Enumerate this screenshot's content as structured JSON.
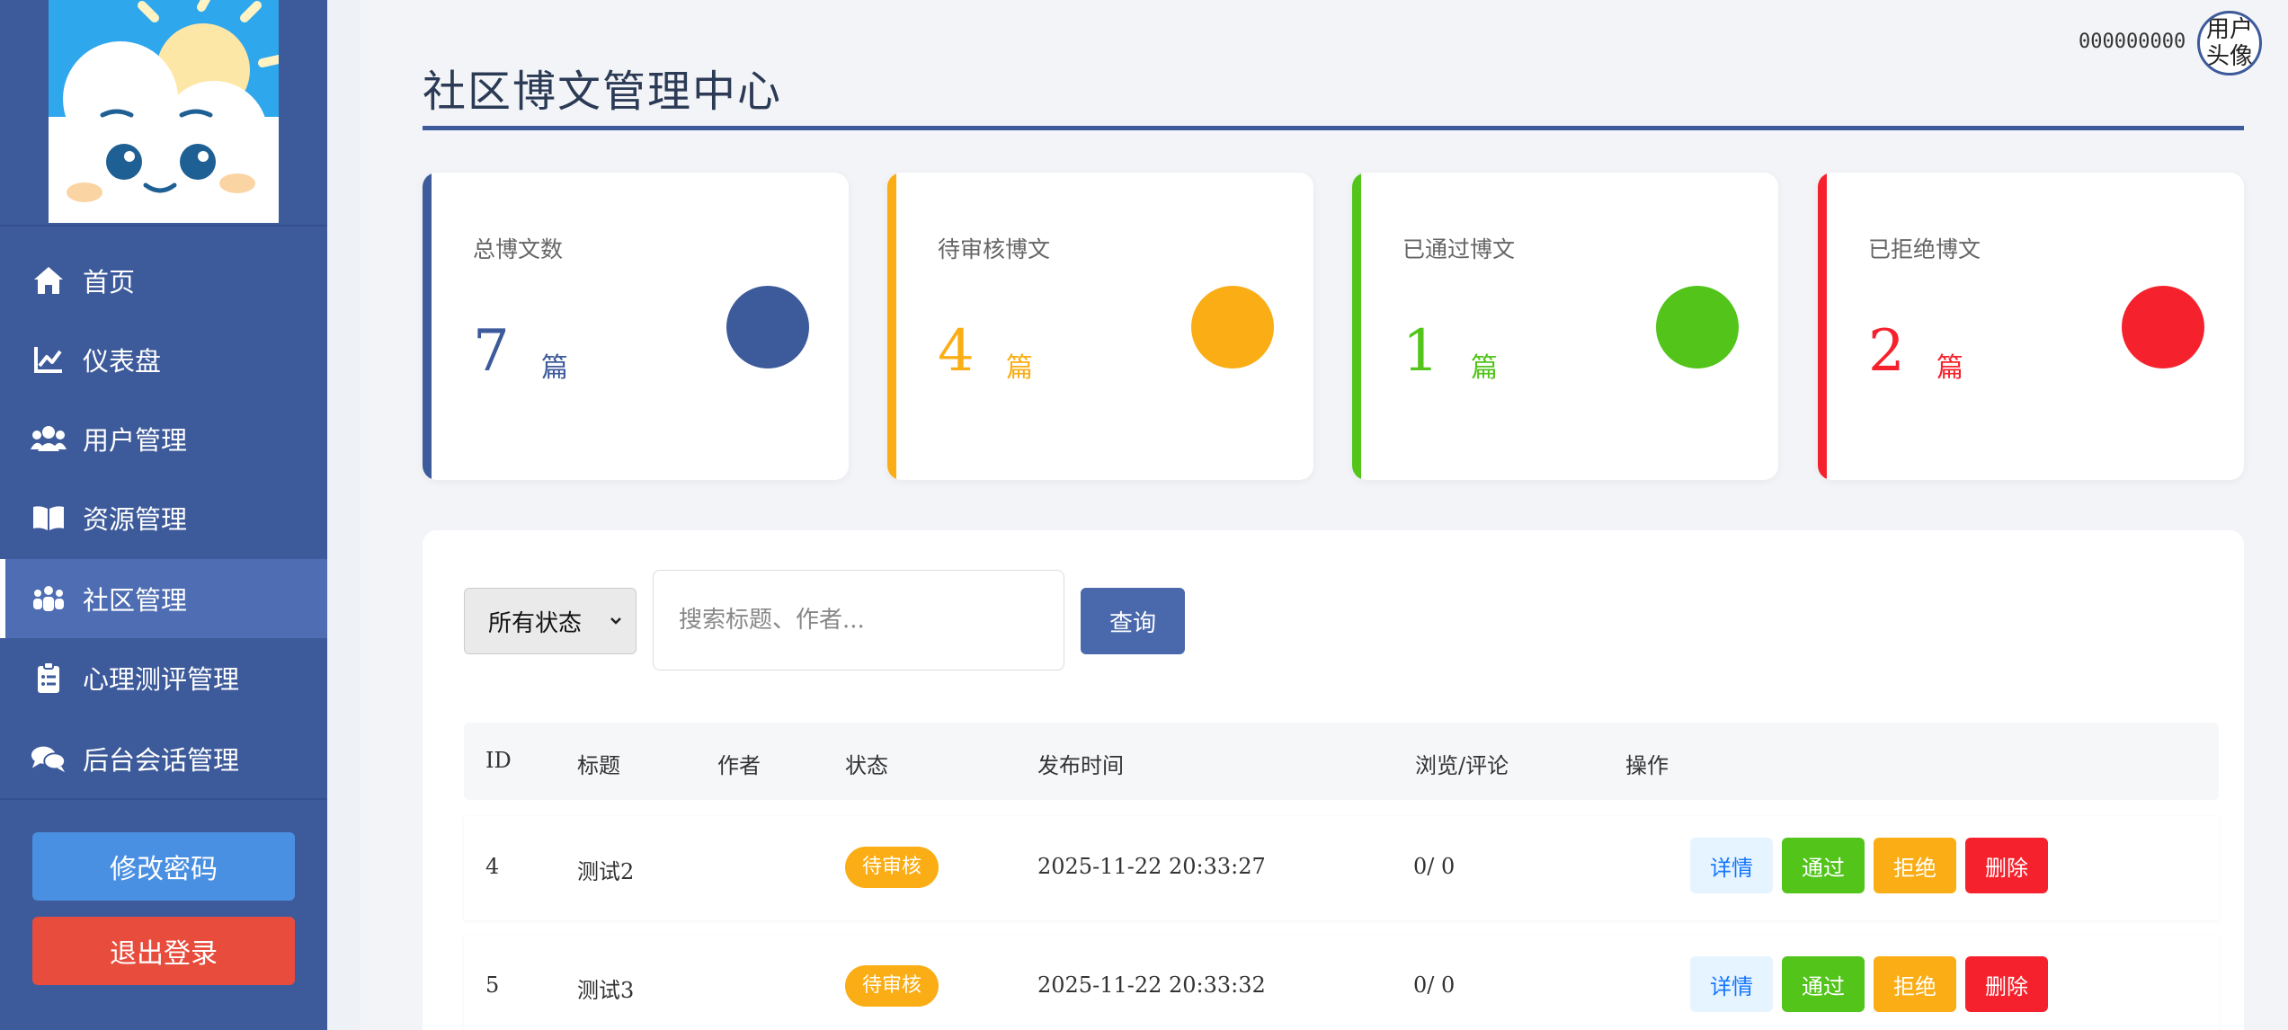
{
  "sidebar": {
    "items": [
      {
        "label": "首页",
        "icon": "home-icon"
      },
      {
        "label": "仪表盘",
        "icon": "chart-line-icon"
      },
      {
        "label": "用户管理",
        "icon": "users-icon"
      },
      {
        "label": "资源管理",
        "icon": "book-icon"
      },
      {
        "label": "社区管理",
        "icon": "people-group-icon",
        "active": true
      },
      {
        "label": "心理测评管理",
        "icon": "clipboard-list-icon"
      },
      {
        "label": "后台会话管理",
        "icon": "comments-icon"
      }
    ],
    "change_password": "修改密码",
    "logout": "退出登录"
  },
  "header": {
    "title": "社区博文管理中心",
    "user_id": "000000000",
    "avatar_text": "用户头像"
  },
  "stats": [
    {
      "label": "总博文数",
      "value": "7",
      "unit": "篇",
      "color": "#3d5a9b"
    },
    {
      "label": "待审核博文",
      "value": "4",
      "unit": "篇",
      "color": "#faad14"
    },
    {
      "label": "已通过博文",
      "value": "1",
      "unit": "篇",
      "color": "#52c41a"
    },
    {
      "label": "已拒绝博文",
      "value": "2",
      "unit": "篇",
      "color": "#f5222d"
    }
  ],
  "filters": {
    "status_selected": "所有状态",
    "search_placeholder": "搜索标题、作者...",
    "query_label": "查询"
  },
  "table": {
    "columns": [
      "ID",
      "标题",
      "作者",
      "状态",
      "发布时间",
      "浏览/评论",
      "操作"
    ],
    "rows": [
      {
        "id": "4",
        "title": "测试2",
        "author": "",
        "status": "待审核",
        "time": "2025-11-22 20:33:27",
        "views": "0/ 0"
      },
      {
        "id": "5",
        "title": "测试3",
        "author": "",
        "status": "待审核",
        "time": "2025-11-22 20:33:32",
        "views": "0/ 0"
      }
    ],
    "actions": {
      "detail": "详情",
      "pass": "通过",
      "reject": "拒绝",
      "delete": "删除"
    }
  },
  "colors": {
    "sidebar_bg": "#3d5a9b",
    "primary": "#3d5a9b",
    "pending": "#faad14",
    "approved": "#52c41a",
    "rejected": "#f5222d"
  }
}
